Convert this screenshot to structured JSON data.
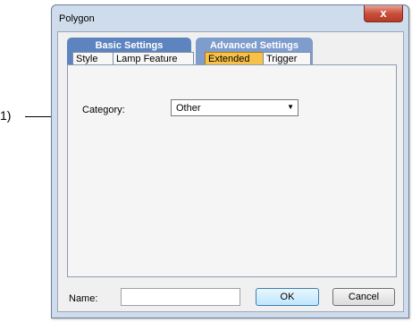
{
  "annotation": {
    "callout": "1)"
  },
  "dialog": {
    "title": "Polygon",
    "close_label": "x",
    "tab_groups": [
      {
        "label": "Basic Settings",
        "tabs": [
          "Style",
          "Lamp Feature"
        ]
      },
      {
        "label": "Advanced Settings",
        "tabs": [
          "Extended",
          "Trigger"
        ]
      }
    ],
    "active_tab": "Extended",
    "category": {
      "label": "Category:",
      "value": "Other"
    },
    "name": {
      "label": "Name:",
      "value": ""
    },
    "buttons": {
      "ok": "OK",
      "cancel": "Cancel"
    }
  }
}
